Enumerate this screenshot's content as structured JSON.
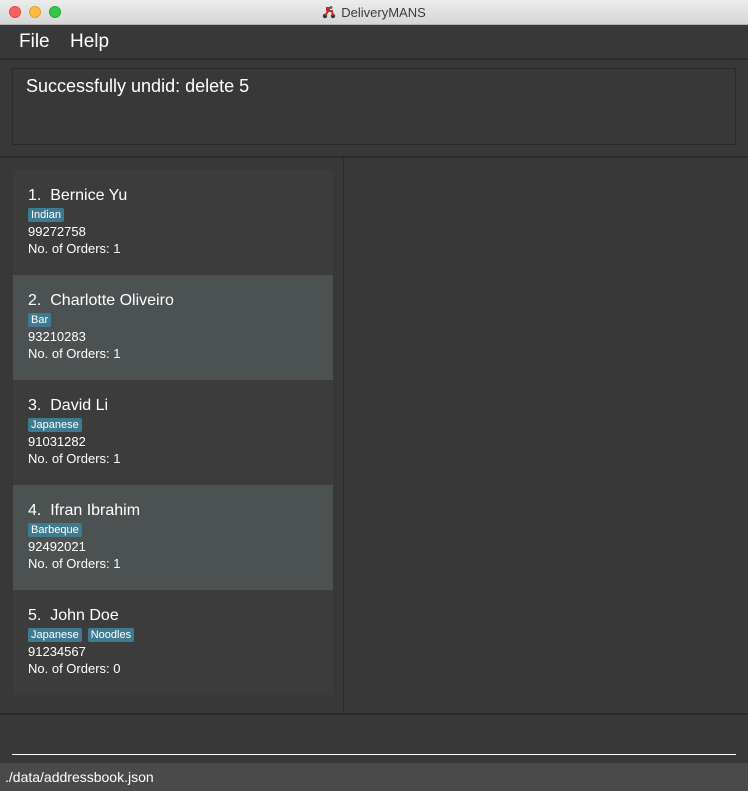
{
  "window": {
    "title": "DeliveryMANS",
    "app_icon": "delivery-scooter-icon"
  },
  "menu": {
    "file_label": "File",
    "help_label": "Help"
  },
  "result_display": {
    "message": "Successfully undid: delete 5"
  },
  "restaurants": [
    {
      "title": "1.  Bernice Yu",
      "tags": [
        "Indian"
      ],
      "phone": "99272758",
      "orders": "No. of Orders: 1"
    },
    {
      "title": "2.  Charlotte Oliveiro",
      "tags": [
        "Bar"
      ],
      "phone": "93210283",
      "orders": "No. of Orders: 1"
    },
    {
      "title": "3.  David Li",
      "tags": [
        "Japanese"
      ],
      "phone": "91031282",
      "orders": "No. of Orders: 1"
    },
    {
      "title": "4.  Ifran Ibrahim",
      "tags": [
        "Barbeque"
      ],
      "phone": "92492021",
      "orders": "No. of Orders: 1"
    },
    {
      "title": "5.  John Doe",
      "tags": [
        "Japanese",
        "Noodles"
      ],
      "phone": "91234567",
      "orders": "No. of Orders: 0"
    }
  ],
  "command_box": {
    "value": ""
  },
  "status_bar": {
    "save_location": "./data/addressbook.json"
  },
  "colors": {
    "background": "#383838",
    "card_alt": "#4c5152",
    "tag": "#3e7b91"
  }
}
